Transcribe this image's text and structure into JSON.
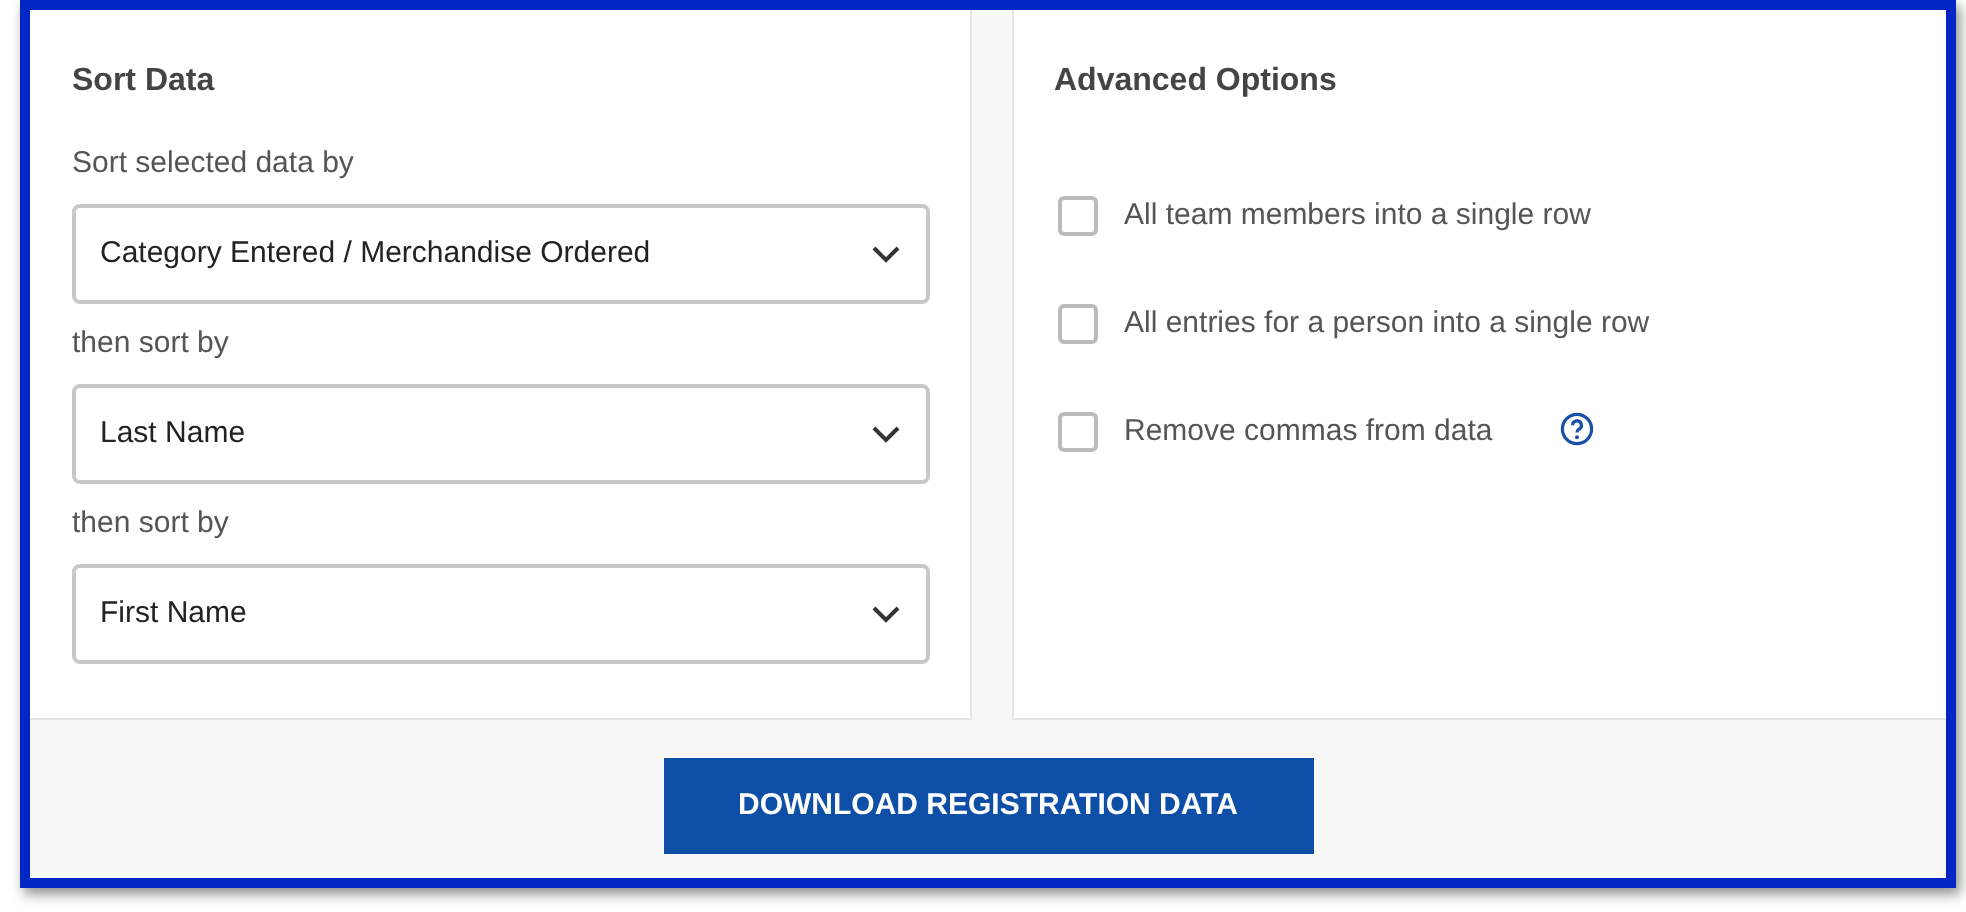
{
  "sort_data": {
    "title": "Sort Data",
    "fields": [
      {
        "label": "Sort selected data by",
        "value": "Category Entered / Merchandise Ordered"
      },
      {
        "label": "then sort by",
        "value": "Last Name"
      },
      {
        "label": "then sort by",
        "value": "First Name"
      }
    ]
  },
  "advanced_options": {
    "title": "Advanced Options",
    "options": [
      {
        "label": "All team members into a single row",
        "checked": false,
        "help": false
      },
      {
        "label": "All entries for a person into a single row",
        "checked": false,
        "help": false
      },
      {
        "label": "Remove commas from data",
        "checked": false,
        "help": true
      }
    ]
  },
  "download_button": "DOWNLOAD REGISTRATION DATA"
}
